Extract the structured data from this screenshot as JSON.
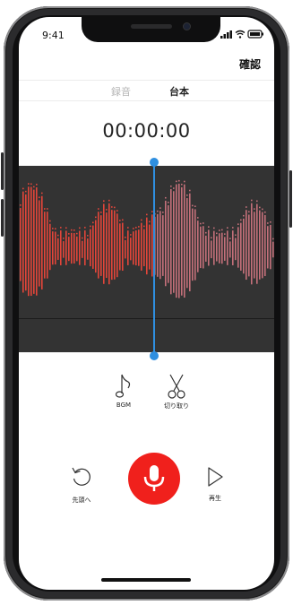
{
  "status_bar": {
    "time": "9:41"
  },
  "header": {
    "confirm_label": "確認"
  },
  "tabs": [
    {
      "label": "録音",
      "active": false
    },
    {
      "label": "台本",
      "active": true
    }
  ],
  "timer": "00:00:00",
  "waveform": {
    "recorded_color": "#e2453a",
    "unrecorded_color": "#c4707a",
    "background": "#333333"
  },
  "tools": {
    "bgm": {
      "label": "BGM",
      "icon": "music-note-icon"
    },
    "cut": {
      "label": "切り取り",
      "icon": "scissors-icon"
    }
  },
  "controls": {
    "rewind": {
      "label": "先頭へ",
      "icon": "rewind-icon"
    },
    "record": {
      "icon": "microphone-icon",
      "color": "#f0201c"
    },
    "play": {
      "label": "再生",
      "icon": "play-icon"
    }
  },
  "accent_color": "#2f8fe0"
}
